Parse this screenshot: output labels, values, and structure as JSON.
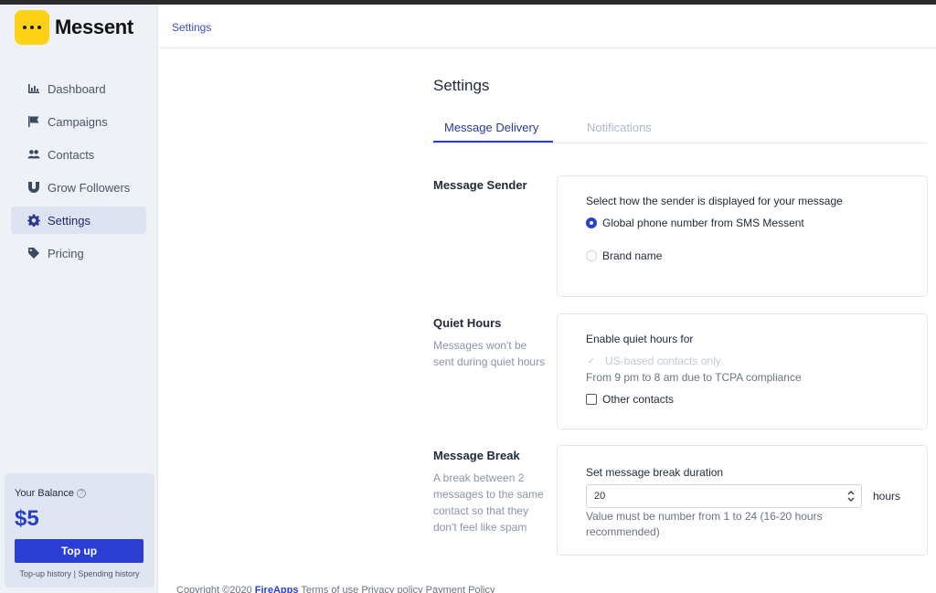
{
  "brand": {
    "name": "Messent"
  },
  "sidebar": {
    "items": [
      {
        "label": "Dashboard",
        "icon": "chart-icon"
      },
      {
        "label": "Campaigns",
        "icon": "flag-icon"
      },
      {
        "label": "Contacts",
        "icon": "users-icon"
      },
      {
        "label": "Grow Followers",
        "icon": "magnet-icon"
      },
      {
        "label": "Settings",
        "icon": "gear-icon",
        "active": true
      },
      {
        "label": "Pricing",
        "icon": "tag-icon"
      }
    ],
    "balance": {
      "label": "Your Balance",
      "amount": "$5",
      "topup_label": "Top up",
      "topup_history": "Top-up history",
      "separator": "|",
      "spending_history": "Spending history"
    }
  },
  "header": {
    "breadcrumb": "Settings"
  },
  "main": {
    "title": "Settings",
    "tabs": [
      {
        "label": "Message Delivery",
        "active": true
      },
      {
        "label": "Notifications",
        "active": false
      }
    ],
    "sender": {
      "title": "Message Sender",
      "prompt": "Select how the sender is displayed for your message",
      "options": [
        {
          "label": "Global phone number from SMS Messent",
          "checked": true
        },
        {
          "label": "Brand name",
          "checked": false
        }
      ]
    },
    "quiet_hours": {
      "title": "Quiet Hours",
      "description": "Messages won't be sent during quiet hours",
      "prompt": "Enable quiet hours for",
      "us_option": "US-based contacts only",
      "us_note": "From 9 pm to 8 am due to TCPA compliance",
      "other_option": "Other contacts"
    },
    "message_break": {
      "title": "Message Break",
      "description": "A break between 2 messages to the same contact so that they don't feel like spam",
      "prompt": "Set message break duration",
      "value": "20",
      "unit": "hours",
      "hint": "Value must be number from 1 to 24 (16-20 hours recommended)"
    }
  },
  "footer": {
    "prefix": "Copyright ©2020",
    "company": "FireApps",
    "links": "Terms of use   Privacy policy   Payment Policy"
  },
  "colors": {
    "accent": "#2b3ed4",
    "logo": "#fcd116",
    "sidebar_bg": "#eef1f6"
  }
}
